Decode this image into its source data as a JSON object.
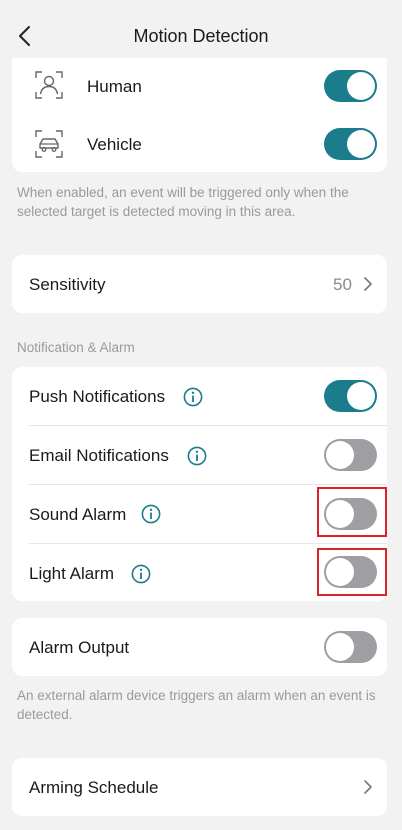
{
  "header": {
    "title": "Motion Detection"
  },
  "targets": {
    "items": [
      {
        "label": "Human",
        "icon": "human-target-icon",
        "enabled": true
      },
      {
        "label": "Vehicle",
        "icon": "vehicle-target-icon",
        "enabled": true
      }
    ],
    "note": "When enabled, an event will be triggered only when the selected target is detected moving in this area."
  },
  "sensitivity": {
    "label": "Sensitivity",
    "value": "50"
  },
  "notification": {
    "section_label": "Notification & Alarm",
    "items": [
      {
        "label": "Push Notifications",
        "enabled": true
      },
      {
        "label": "Email Notifications",
        "enabled": false
      },
      {
        "label": "Sound Alarm",
        "enabled": false
      },
      {
        "label": "Light Alarm",
        "enabled": false
      }
    ]
  },
  "alarm_output": {
    "label": "Alarm Output",
    "enabled": false,
    "note": "An external alarm device triggers an alarm when an event is detected."
  },
  "arming_schedule": {
    "label": "Arming Schedule"
  },
  "colors": {
    "accent": "#1b7c8c",
    "toggle_off": "#9e9ea3",
    "highlight": "#d9252a",
    "background": "#f2f2f2"
  }
}
